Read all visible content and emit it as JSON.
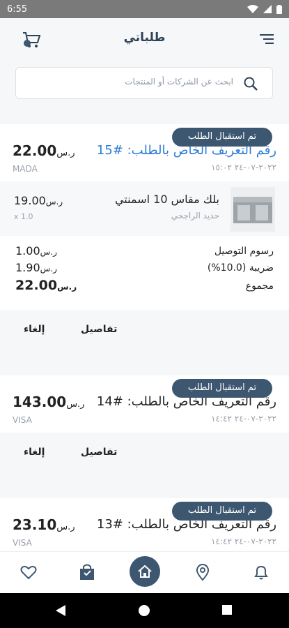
{
  "status": {
    "time": "6:55"
  },
  "header": {
    "title": "طلباتي"
  },
  "search": {
    "placeholder": "ابحث عن الشركات أو المنتجات"
  },
  "orders": [
    {
      "status": "تم استقبال الطلب",
      "id_label": "رقم التعريف الخاص بالطلب: #15",
      "date": "٢٠٢٢-٠٧-٢٤ ١٥:٠٢",
      "amount": "22.00",
      "currency": "ر.س",
      "method": "MADA",
      "item": {
        "name": "بلك مقاس 10 اسمنتي",
        "brand": "حديد الراجحي",
        "price": "19.00",
        "qty": "x 1.0"
      },
      "delivery_label": "رسوم التوصيل",
      "delivery_value": "1.00",
      "tax_label": "ضريبة (10.0%)",
      "tax_value": "1.90",
      "total_label": "مجموع",
      "total_value": "22.00",
      "details": "تفاصيل",
      "cancel": "إلغاء"
    },
    {
      "status": "تم استقبال الطلب",
      "id_label": "رقم التعريف الخاص بالطلب: #14",
      "date": "٢٠٢٢-٠٧-٢٤ ١٤:٤٢",
      "amount": "143.00",
      "currency": "ر.س",
      "method": "VISA",
      "details": "تفاصيل",
      "cancel": "إلغاء"
    },
    {
      "status": "تم استقبال الطلب",
      "id_label": "رقم التعريف الخاص بالطلب: #13",
      "date": "٢٠٢٢-٠٧-٢٤ ١٤:٤٢",
      "amount": "23.10",
      "currency": "ر.س",
      "method": "VISA"
    }
  ],
  "nav": {
    "icons": [
      "heart-icon",
      "bag-icon",
      "home-icon",
      "location-icon",
      "bell-icon"
    ]
  },
  "colors": {
    "accent": "#3e5771",
    "link": "#2c7cd6"
  }
}
